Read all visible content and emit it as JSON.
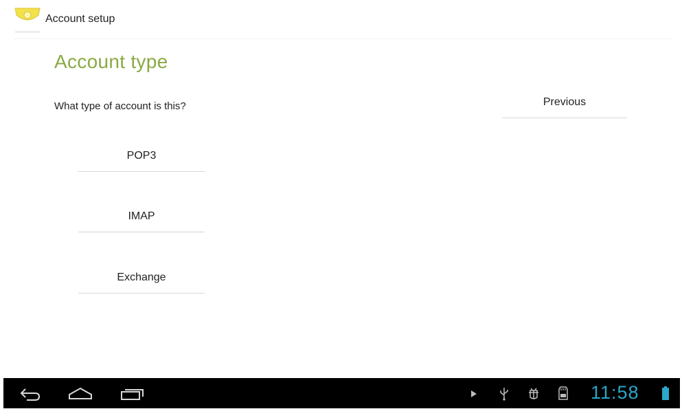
{
  "action_bar": {
    "title": "Account setup",
    "app_icon": "email-app-icon"
  },
  "page": {
    "heading": "Account type",
    "question": "What type of account is this?"
  },
  "buttons": {
    "previous": "Previous",
    "pop3": "POP3",
    "imap": "IMAP",
    "exchange": "Exchange"
  },
  "nav_bar": {
    "icons": [
      "back-icon",
      "home-icon",
      "recent-apps-icon"
    ],
    "status_icons": [
      "play-icon",
      "usb-icon",
      "debug-icon",
      "sd-card-icon",
      "battery-icon"
    ],
    "time": "11:58"
  },
  "colors": {
    "heading": "#8aa943",
    "clock": "#2aa7c9",
    "nav_bar": "#000000",
    "app_icon": "#f3e14a"
  }
}
